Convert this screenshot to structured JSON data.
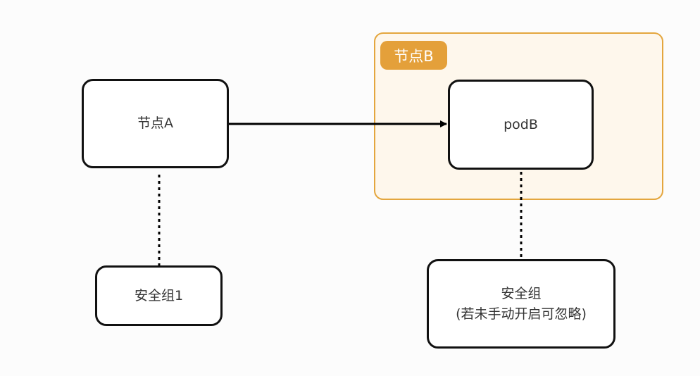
{
  "diagram": {
    "groups": [
      {
        "id": "node-b",
        "label": "节点B"
      }
    ],
    "nodes": [
      {
        "id": "node-a",
        "lines": [
          "节点A"
        ]
      },
      {
        "id": "pod-b",
        "lines": [
          "podB"
        ]
      },
      {
        "id": "security-group-1",
        "lines": [
          "安全组1"
        ]
      },
      {
        "id": "security-group-2",
        "lines": [
          "安全组",
          "(若未手动开启可忽略)"
        ]
      }
    ],
    "edges": [
      {
        "from": "node-a",
        "to": "pod-b",
        "style": "solid-arrow"
      },
      {
        "from": "node-a",
        "to": "security-group-1",
        "style": "dotted"
      },
      {
        "from": "pod-b",
        "to": "security-group-2",
        "style": "dotted"
      }
    ],
    "colors": {
      "group_border": "#e4a63e",
      "group_fill": "#fef7ec",
      "group_label_fill": "#e4a03a",
      "node_border": "#111111",
      "edge": "#000000"
    }
  }
}
